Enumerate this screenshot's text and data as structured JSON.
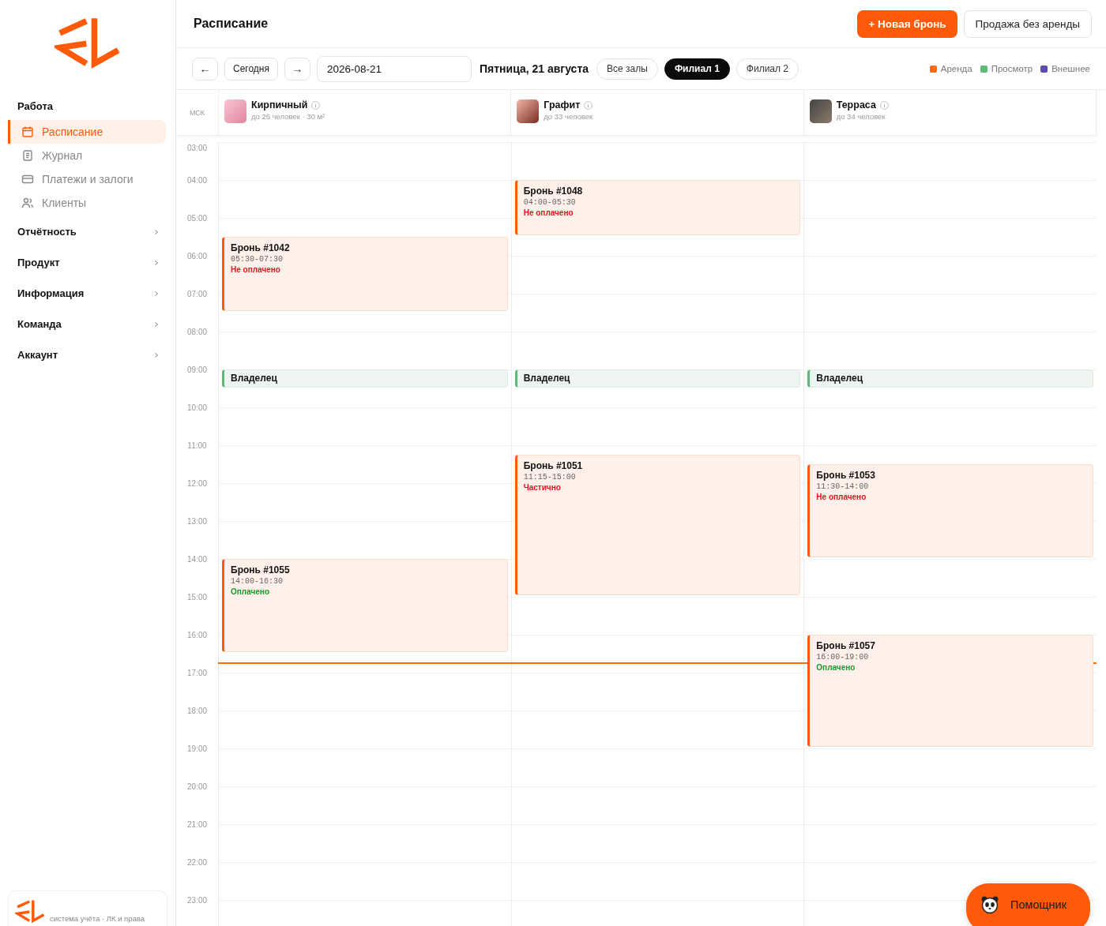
{
  "page_title": "Расписание",
  "actions": [
    {
      "label": "+ Новая бронь",
      "kind": "primary"
    },
    {
      "label": "Продажа без аренды",
      "kind": "secondary"
    }
  ],
  "toolbar": {
    "prev": "←",
    "today": "Сегодня",
    "next": "→",
    "date": {
      "value": "2026-08-21"
    },
    "date_label": "Пятница, 21 августа",
    "filters": [
      {
        "label": "Все залы",
        "selected": false
      },
      {
        "label": "Филиал 1",
        "selected": true
      },
      {
        "label": "Филиал 2",
        "selected": false
      }
    ],
    "legend": [
      {
        "label": "Аренда",
        "color": "#ff6a13"
      },
      {
        "label": "Просмотр",
        "color": "#5dbb7a"
      },
      {
        "label": "Внешнее",
        "color": "#5a4bb5"
      }
    ]
  },
  "sidebar": {
    "sections": [
      {
        "title": "Работа",
        "expanded": true,
        "items": [
          {
            "label": "Расписание",
            "selected": true
          },
          {
            "label": "Журнал",
            "selected": false
          },
          {
            "label": "Платежи и залоги",
            "selected": false
          },
          {
            "label": "Клиенты",
            "selected": false
          }
        ]
      },
      {
        "title": "Отчётность",
        "expanded": false
      },
      {
        "title": "Продукт",
        "expanded": false
      },
      {
        "title": "Информация",
        "expanded": false
      },
      {
        "title": "Команда",
        "expanded": false
      },
      {
        "title": "Аккаунт",
        "expanded": false
      }
    ],
    "footer": "система учёта · ЛК и права"
  },
  "schedule": {
    "timezone": "МСК",
    "hours": [
      "03:00",
      "04:00",
      "05:00",
      "06:00",
      "07:00",
      "08:00",
      "09:00",
      "10:00",
      "11:00",
      "12:00",
      "13:00",
      "14:00",
      "15:00",
      "16:00",
      "17:00",
      "18:00",
      "19:00",
      "20:00",
      "21:00",
      "22:00",
      "23:00"
    ],
    "rooms": [
      {
        "name": "Кирпичный",
        "capacity": "до 25 человек · 30 м²",
        "events": [
          {
            "kind": "booking",
            "title": "Бронь #1042",
            "time": "05:30-07:30",
            "status": {
              "label": "Не оплачено",
              "color": "#e8141e"
            }
          },
          {
            "kind": "owner",
            "title": "Владелец"
          },
          {
            "kind": "booking",
            "title": "Бронь #1055",
            "time": "14:00-16:30",
            "status": {
              "label": "Оплачено",
              "color": "#1a9a2a"
            }
          }
        ]
      },
      {
        "name": "Графит",
        "capacity": "до 33 человек",
        "events": [
          {
            "kind": "booking",
            "title": "Бронь #1048",
            "time": "04:00-05:30",
            "status": {
              "label": "Не оплачено",
              "color": "#e8141e"
            }
          },
          {
            "kind": "owner",
            "title": "Владелец"
          },
          {
            "kind": "booking",
            "title": "Бронь #1051",
            "time": "11:15-15:00",
            "status": {
              "label": "Частично",
              "color": "#e8141e"
            }
          }
        ]
      },
      {
        "name": "Терраса",
        "capacity": "до 34 человек",
        "events": [
          {
            "kind": "owner",
            "title": "Владелец"
          },
          {
            "kind": "booking",
            "title": "Бронь #1053",
            "time": "11:30-14:00",
            "status": {
              "label": "Не оплачено",
              "color": "#e8141e"
            }
          },
          {
            "kind": "booking",
            "title": "Бронь #1057",
            "time": "16:00-19:00",
            "status": {
              "label": "Оплачено",
              "color": "#1a9a2a"
            }
          }
        ]
      }
    ]
  },
  "assistant": {
    "label": "Помощник"
  }
}
